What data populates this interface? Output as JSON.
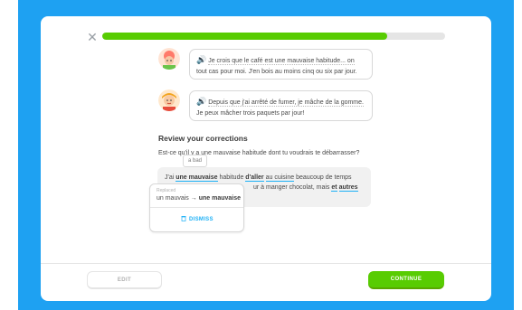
{
  "colors": {
    "accent": "#58cc02",
    "link": "#1cb0f6",
    "background": "#1ea1f2"
  },
  "progress": {
    "fraction": 0.83
  },
  "close": {
    "icon": "close-icon",
    "glyph": "✕"
  },
  "messages": [
    {
      "speaker_icon": "speaker-icon",
      "speaker": "🔊",
      "line1": "Je crois que le café est une mauvaise habitude... on",
      "line2": "tout cas pour moi. J'en bois au moins cinq ou six par jour."
    },
    {
      "speaker_icon": "speaker-icon",
      "speaker": "🔊",
      "line1": "Depuis que j'ai arrêté de fumer, je mâche de la gomme.",
      "line2": "Je peux mâcher trois paquets par jour!"
    }
  ],
  "review": {
    "title": "Review your corrections",
    "question": "Est-ce qu'il y a une mauvaise habitude dont tu voudrais te débarrasser?",
    "answer": {
      "p1": "J'ai ",
      "c1": "une mauvaise",
      "p2": " habitude ",
      "c2": "d'aller",
      "p3": " ",
      "c3": "au cuisine",
      "p4": " beaucoup de temps",
      "line2_a": "ur à manger chocolat, mais ",
      "line2_b": "et",
      "line2_c": " ",
      "line2_d": "autres"
    },
    "tooltip": "a bad",
    "popup": {
      "label": "Replaced",
      "old": "un mauvais",
      "arrow": "→",
      "new": "une mauvaise",
      "dismiss_icon": "trash-icon",
      "dismiss": "DISMISS"
    }
  },
  "footer": {
    "edit": "EDIT",
    "continue": "CONTINUE"
  }
}
